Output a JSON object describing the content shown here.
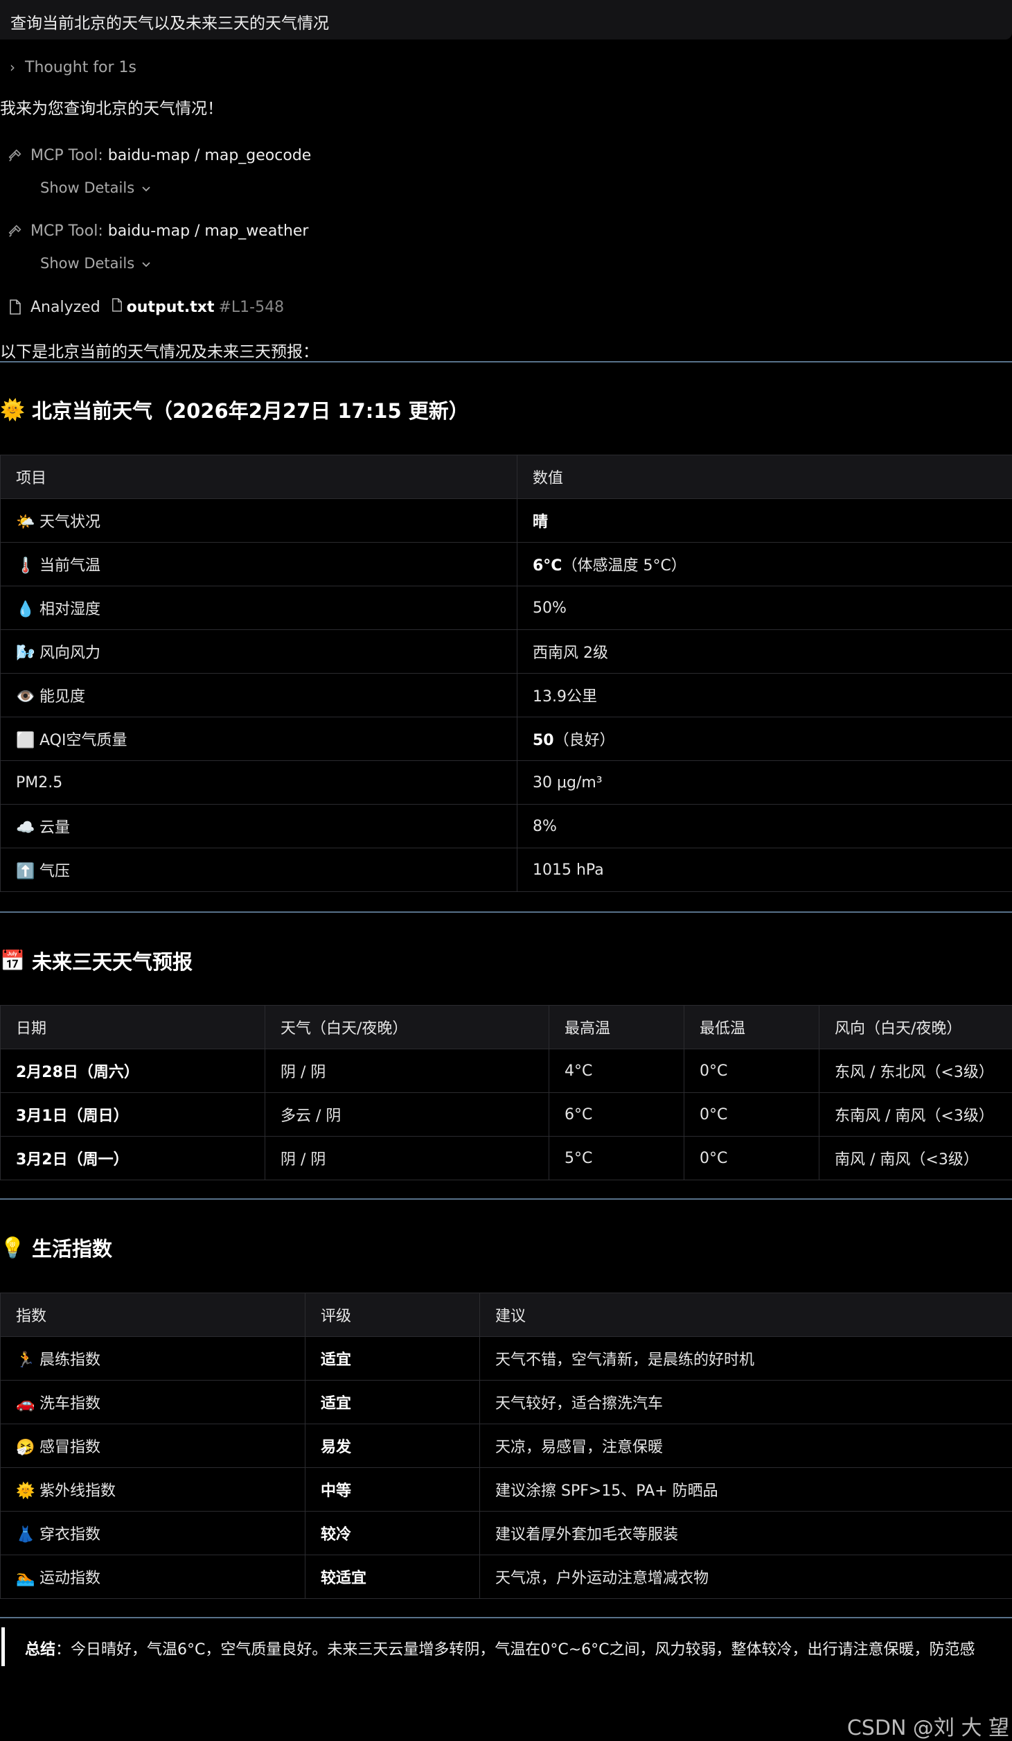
{
  "query": "查询当前北京的天气以及未来三天的天气情况",
  "thought": {
    "label": "Thought for 1s"
  },
  "intro": "我来为您查询北京的天气情况！",
  "tools": [
    {
      "prefix": "MCP Tool:",
      "name": "baidu-map / map_geocode",
      "details_label": "Show Details"
    },
    {
      "prefix": "MCP Tool:",
      "name": "baidu-map / map_weather",
      "details_label": "Show Details"
    }
  ],
  "analyzed": {
    "label": "Analyzed",
    "file": "output.txt",
    "range": "#L1-548"
  },
  "lead": "以下是北京当前的天气情况及未来三天预报：",
  "current": {
    "emoji": "🌞",
    "title": "北京当前天气（2026年2月27日 17:15 更新）",
    "headers": [
      "项目",
      "数值"
    ],
    "rows": [
      {
        "emoji": "🌤️",
        "label": "天气状况",
        "value_bold": "晴",
        "value_rest": ""
      },
      {
        "emoji": "🌡️",
        "label": "当前气温",
        "value_bold": "6°C",
        "value_rest": "（体感温度 5°C）"
      },
      {
        "emoji": "💧",
        "label": "相对湿度",
        "value_bold": "",
        "value_rest": "50%"
      },
      {
        "emoji": "🌬️",
        "label": "风向风力",
        "value_bold": "",
        "value_rest": "西南风 2级"
      },
      {
        "emoji": "👁️",
        "label": "能见度",
        "value_bold": "",
        "value_rest": "13.9公里"
      },
      {
        "emoji": "⬜",
        "label": "AQI空气质量",
        "value_bold": "50",
        "value_rest": "（良好）"
      },
      {
        "emoji": "",
        "label": "PM2.5",
        "value_bold": "",
        "value_rest": "30 μg/m³"
      },
      {
        "emoji": "☁️",
        "label": "云量",
        "value_bold": "",
        "value_rest": "8%"
      },
      {
        "emoji": "⬆️",
        "label": "气压",
        "value_bold": "",
        "value_rest": "1015 hPa"
      }
    ]
  },
  "forecast": {
    "emoji": "📅",
    "title": "未来三天天气预报",
    "headers": [
      "日期",
      "天气（白天/夜晚）",
      "最高温",
      "最低温",
      "风向（白天/夜晚）"
    ],
    "rows": [
      {
        "date": "2月28日（周六）",
        "weather": "阴 / 阴",
        "high": "4°C",
        "low": "0°C",
        "wind": "东风 / 东北风（<3级）"
      },
      {
        "date": "3月1日（周日）",
        "weather": "多云 / 阴",
        "high": "6°C",
        "low": "0°C",
        "wind": "东南风 / 南风（<3级）"
      },
      {
        "date": "3月2日（周一）",
        "weather": "阴 / 阴",
        "high": "5°C",
        "low": "0°C",
        "wind": "南风 / 南风（<3级）"
      }
    ]
  },
  "life": {
    "emoji": "💡",
    "title": "生活指数",
    "headers": [
      "指数",
      "评级",
      "建议"
    ],
    "rows": [
      {
        "emoji": "🏃",
        "name": "晨练指数",
        "level": "适宜",
        "advice": "天气不错，空气清新，是晨练的好时机"
      },
      {
        "emoji": "🚗",
        "name": "洗车指数",
        "level": "适宜",
        "advice": "天气较好，适合擦洗汽车"
      },
      {
        "emoji": "🤧",
        "name": "感冒指数",
        "level": "易发",
        "advice": "天凉，易感冒，注意保暖"
      },
      {
        "emoji": "🌞",
        "name": "紫外线指数",
        "level": "中等",
        "advice": "建议涂擦 SPF>15、PA+ 防晒品"
      },
      {
        "emoji": "👗",
        "name": "穿衣指数",
        "level": "较冷",
        "advice": "建议着厚外套加毛衣等服装"
      },
      {
        "emoji": "🏊",
        "name": "运动指数",
        "level": "较适宜",
        "advice": "天气凉，户外运动注意增减衣物"
      }
    ]
  },
  "summary": {
    "label": "总结",
    "text": "：今日晴好，气温6°C，空气质量良好。未来三天云量增多转阴，气温在0°C~6°C之间，风力较弱，整体较冷，出行请注意保暖，防范感"
  },
  "watermark": "CSDN @刘 大 望"
}
